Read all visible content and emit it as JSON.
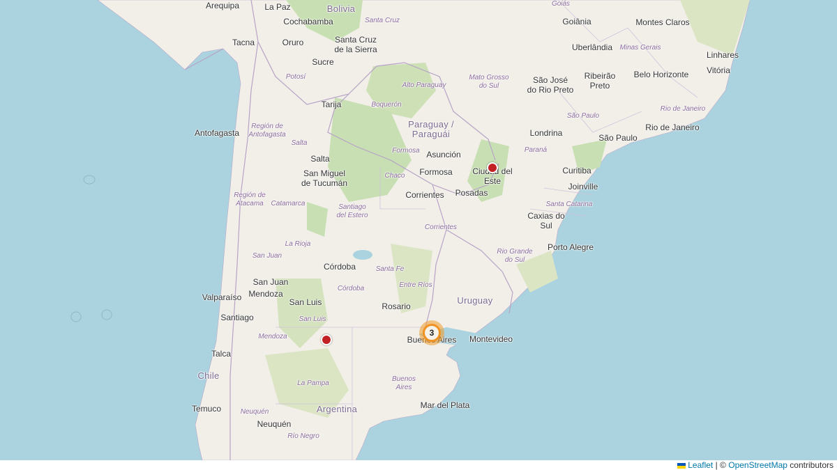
{
  "map": {
    "countries": [
      "Bolivia",
      "Paraguay /\nParaguái",
      "Uruguay",
      "Chile",
      "Argentina"
    ],
    "cities": [
      "Arequipa",
      "La Paz",
      "Cochabamba",
      "Santa Cruz\nde la Sierra",
      "Tacna",
      "Oruro",
      "Sucre",
      "Tarija",
      "Antofagasta",
      "Salta",
      "San Miguel\nde Tucumán",
      "Asunción",
      "Formosa",
      "Corrientes",
      "Posadas",
      "Ciudad del\nEste",
      "Goiânia",
      "Montes Claros",
      "Uberlândia",
      "Linhares",
      "Vitória",
      "Belo Horizonte",
      "São José\ndo Rio Preto",
      "Ribeirão\nPreto",
      "Londrina",
      "São Paulo",
      "Rio de Janeiro",
      "Curitiba",
      "Joinville",
      "Caxias do\nSul",
      "Porto Alegre",
      "Córdoba",
      "San Juan",
      "Mendoza",
      "San Luis",
      "Rosario",
      "Valparaíso",
      "Santiago",
      "Talca",
      "Buenos Aires",
      "Montevideo",
      "Mar del Plata",
      "Temuco",
      "Neuquén"
    ],
    "regions": [
      "Goiás",
      "Santa Cruz",
      "Minas Gerais",
      "Potosí",
      "Alto Paraguay",
      "Mato Grosso\ndo Sul",
      "Boquerón",
      "São Paulo",
      "Rio de Janeiro",
      "Región de\nAntofagasta",
      "Salta",
      "Formosa",
      "Chaco",
      "Paraná",
      "Región de\nAtacama",
      "Catamarca",
      "Santiago\ndel Estero",
      "Santa Catarina",
      "Corrientes",
      "Rio Grande\ndo Sul",
      "La Rioja",
      "San Juan",
      "Santa Fe",
      "Entre Ríos",
      "Córdoba",
      "San Luis",
      "Mendoza",
      "La Pampa",
      "Buenos\nAires",
      "Neuquén",
      "Río Negro"
    ]
  },
  "markers": [
    {
      "name": "marker-ciudad-del-este"
    },
    {
      "name": "marker-san-luis-south"
    }
  ],
  "cluster": {
    "count": "3"
  },
  "attribution": {
    "leaflet": "Leaflet",
    "separator": "| ©",
    "osm": "OpenStreetMap",
    "suffix": "contributors"
  },
  "colors": {
    "ocean": "#aad3df",
    "land": "#f2efe9",
    "forest": "#add19e",
    "marker": "#c22226",
    "cluster": "#ef9221",
    "link": "#0078a8"
  }
}
